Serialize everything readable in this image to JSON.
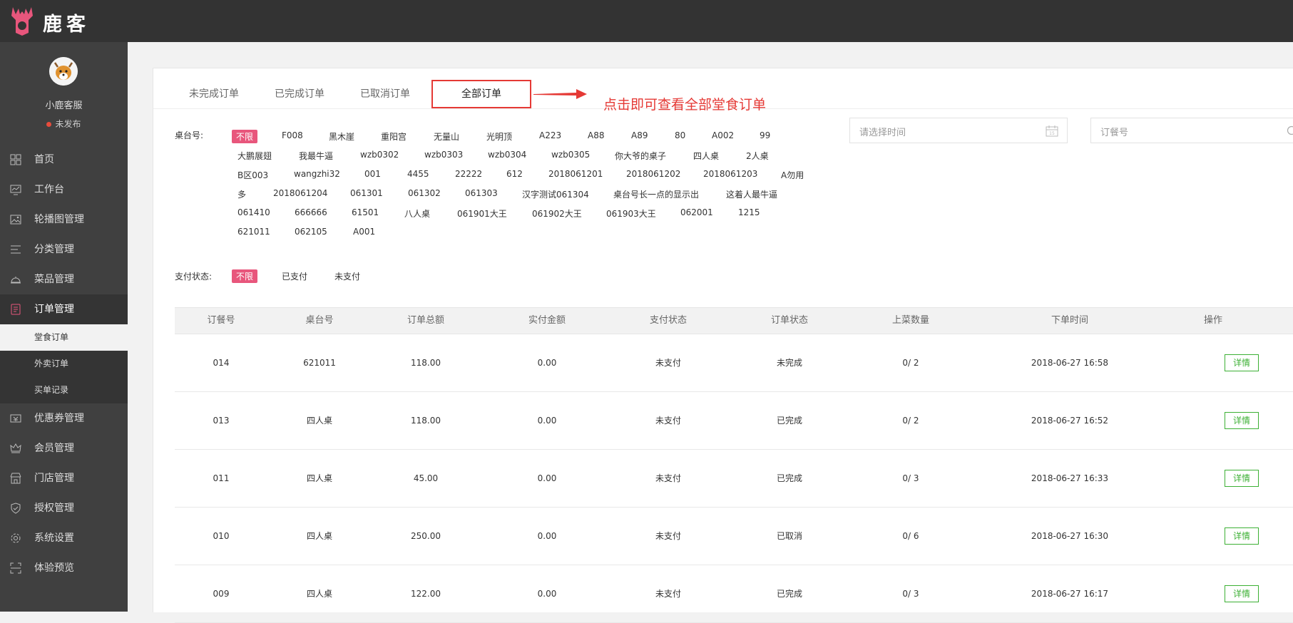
{
  "header": {
    "brand": "鹿客"
  },
  "user": {
    "name": "小鹿客服",
    "status": "未发布"
  },
  "sidebar": {
    "items": [
      {
        "label": "首页",
        "icon": "grid-icon"
      },
      {
        "label": "工作台",
        "icon": "monitor-icon"
      },
      {
        "label": "轮播图管理",
        "icon": "image-icon"
      },
      {
        "label": "分类管理",
        "icon": "list-icon"
      },
      {
        "label": "菜品管理",
        "icon": "dish-cover-icon"
      },
      {
        "label": "订单管理",
        "icon": "order-icon"
      },
      {
        "label": "优惠券管理",
        "icon": "coupon-icon"
      },
      {
        "label": "会员管理",
        "icon": "crown-icon"
      },
      {
        "label": "门店管理",
        "icon": "store-icon"
      },
      {
        "label": "授权管理",
        "icon": "shield-icon"
      },
      {
        "label": "系统设置",
        "icon": "gear-icon"
      },
      {
        "label": "体验预览",
        "icon": "scan-icon"
      }
    ],
    "subitems": [
      {
        "label": "堂食订单"
      },
      {
        "label": "外卖订单"
      },
      {
        "label": "买单记录"
      }
    ]
  },
  "tabs": [
    {
      "label": "未完成订单"
    },
    {
      "label": "已完成订单"
    },
    {
      "label": "已取消订单"
    },
    {
      "label": "全部订单"
    }
  ],
  "annotation": "点击即可查看全部堂食订单",
  "filters": {
    "table_label": "桌台号:",
    "table_options": [
      "不限",
      "F008",
      "黑木崖",
      "重阳宫",
      "无量山",
      "光明顶",
      "A223",
      "A88",
      "A89",
      "80",
      "A002",
      "99",
      "大鹏展翅",
      "我最牛逼",
      "wzb0302",
      "wzb0303",
      "wzb0304",
      "wzb0305",
      "你大爷的桌子",
      "四人桌",
      "2人桌",
      "B区003",
      "wangzhi32",
      "001",
      "4455",
      "22222",
      "612",
      "2018061201",
      "2018061202",
      "2018061203",
      "A勿用",
      "多",
      "2018061204",
      "061301",
      "061302",
      "061303",
      "汉字测试061304",
      "桌台号长一点的显示出",
      "这着人最牛逼",
      "061410",
      "666666",
      "61501",
      "八人桌",
      "061901大王",
      "061902大王",
      "061903大王",
      "062001",
      "1215",
      "621011",
      "062105",
      "A001"
    ],
    "pay_label": "支付状态:",
    "pay_options": [
      "不限",
      "已支付",
      "未支付"
    ]
  },
  "search": {
    "date_placeholder": "请选择时间",
    "order_placeholder": "订餐号"
  },
  "table": {
    "headers": [
      "订餐号",
      "桌台号",
      "订单总额",
      "实付金额",
      "支付状态",
      "订单状态",
      "上菜数量",
      "下单时间",
      "操作"
    ],
    "rows": [
      [
        "014",
        "621011",
        "118.00",
        "0.00",
        "未支付",
        "未完成",
        "0/ 2",
        "2018-06-27 16:58",
        "详情"
      ],
      [
        "013",
        "四人桌",
        "118.00",
        "0.00",
        "未支付",
        "已完成",
        "0/ 2",
        "2018-06-27 16:52",
        "详情"
      ],
      [
        "011",
        "四人桌",
        "45.00",
        "0.00",
        "未支付",
        "已完成",
        "0/ 3",
        "2018-06-27 16:33",
        "详情"
      ],
      [
        "010",
        "四人桌",
        "250.00",
        "0.00",
        "未支付",
        "已取消",
        "0/ 6",
        "2018-06-27 16:30",
        "详情"
      ],
      [
        "009",
        "四人桌",
        "122.00",
        "0.00",
        "未支付",
        "已完成",
        "0/ 3",
        "2018-06-27 16:17",
        "详情"
      ]
    ]
  },
  "colors": {
    "accent_pink": "#e8567c",
    "highlight_red": "#e53935",
    "detail_green": "#3cb034"
  }
}
